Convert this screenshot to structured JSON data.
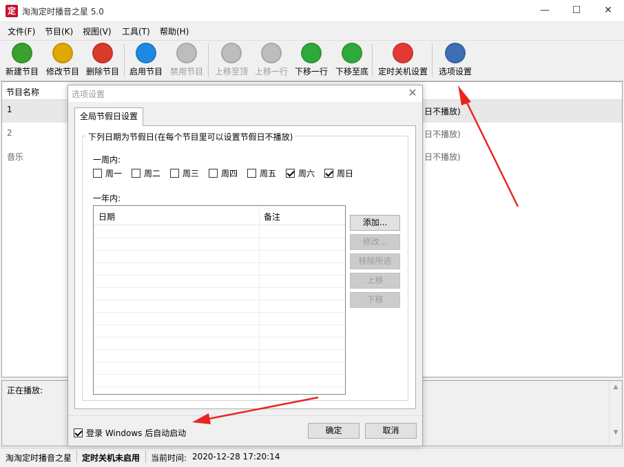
{
  "window": {
    "title": "淘淘定时播音之星 5.0",
    "icon_char": "定",
    "min": "—",
    "max": "☐",
    "close": "✕"
  },
  "menu": [
    "文件(F)",
    "节目(K)",
    "视图(V)",
    "工具(T)",
    "帮助(H)"
  ],
  "toolbar": [
    {
      "label": "新建节目",
      "icon": "new-program-icon",
      "color": "#3aa12f",
      "disabled": false
    },
    {
      "label": "修改节目",
      "icon": "edit-program-icon",
      "color": "#e0a800",
      "disabled": false
    },
    {
      "label": "删除节目",
      "icon": "delete-program-icon",
      "color": "#d93a2b",
      "disabled": false
    },
    {
      "label": "启用节目",
      "icon": "play-icon",
      "color": "#1e88e5",
      "disabled": false
    },
    {
      "label": "禁用节目",
      "icon": "disable-icon",
      "color": "#bdbdbd",
      "disabled": true
    },
    {
      "label": "上移至顶",
      "icon": "move-top-icon",
      "color": "#bdbdbd",
      "disabled": true
    },
    {
      "label": "上移一行",
      "icon": "move-up-icon",
      "color": "#bdbdbd",
      "disabled": true
    },
    {
      "label": "下移一行",
      "icon": "move-down-icon",
      "color": "#2faa3a",
      "disabled": false
    },
    {
      "label": "下移至底",
      "icon": "move-bottom-icon",
      "color": "#2faa3a",
      "disabled": false
    },
    {
      "label": "定时关机设置",
      "icon": "power-icon",
      "color": "#e53935",
      "disabled": false
    },
    {
      "label": "选项设置",
      "icon": "options-icon",
      "color": "#3d6fb4",
      "disabled": false
    }
  ],
  "list": {
    "header": "节目名称",
    "rows": [
      "1",
      "2",
      "音乐"
    ],
    "right_cells": [
      "日不播放)",
      "日不播放)",
      "日不播放)"
    ]
  },
  "playing": {
    "label": "正在播放:"
  },
  "status": {
    "app": "淘淘定时播音之星",
    "shutdown": "定时关机未启用",
    "time_label": "当前时间:",
    "time_value": "2020-12-28 17:20:14"
  },
  "dialog": {
    "title": "选项设置",
    "tab": "全局节假日设置",
    "group_label": "下列日期为节假日(在每个节目里可以设置节假日不播放)",
    "week_label": "一周内:",
    "weekdays": [
      {
        "label": "周一",
        "checked": false
      },
      {
        "label": "周二",
        "checked": false
      },
      {
        "label": "周三",
        "checked": false
      },
      {
        "label": "周四",
        "checked": false
      },
      {
        "label": "周五",
        "checked": false
      },
      {
        "label": "周六",
        "checked": true
      },
      {
        "label": "周日",
        "checked": true
      }
    ],
    "year_label": "一年内:",
    "columns": [
      "日期",
      "备注"
    ],
    "buttons": [
      {
        "label": "添加...",
        "disabled": false
      },
      {
        "label": "修改...",
        "disabled": true
      },
      {
        "label": "移除所选",
        "disabled": true
      },
      {
        "label": "上移",
        "disabled": true
      },
      {
        "label": "下移",
        "disabled": true
      }
    ],
    "autostart": {
      "label": "登录 Windows 后自动启动",
      "checked": true
    },
    "ok": "确定",
    "cancel": "取消"
  },
  "colors": {
    "arrow": "#e8261f",
    "accent": "#0078d7"
  }
}
